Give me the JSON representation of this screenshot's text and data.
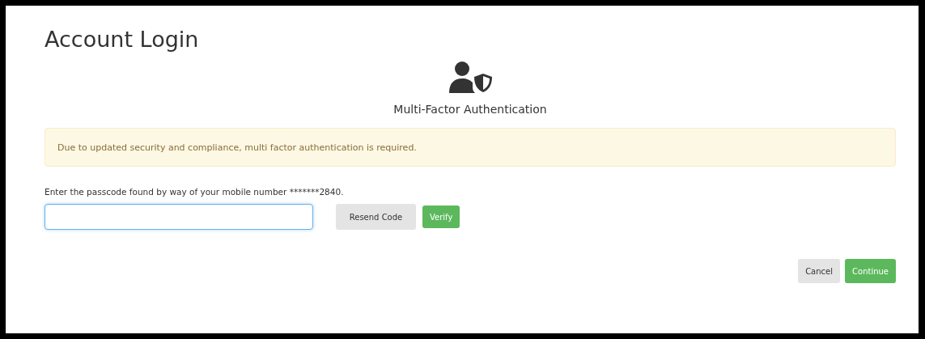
{
  "title": "Account Login",
  "section_title": "Multi-Factor Authentication",
  "alert": "Due to updated security and compliance, multi factor authentication is required.",
  "passcode_label": "Enter the passcode found by way of your mobile number *******2840.",
  "code_buttons": [
    {
      "label": "Resend Code",
      "kind": "default"
    },
    {
      "label": "Verify",
      "kind": "primary"
    }
  ],
  "footer_buttons": [
    {
      "label": "Cancel",
      "kind": "default"
    },
    {
      "label": "Continue",
      "kind": "primary"
    }
  ]
}
